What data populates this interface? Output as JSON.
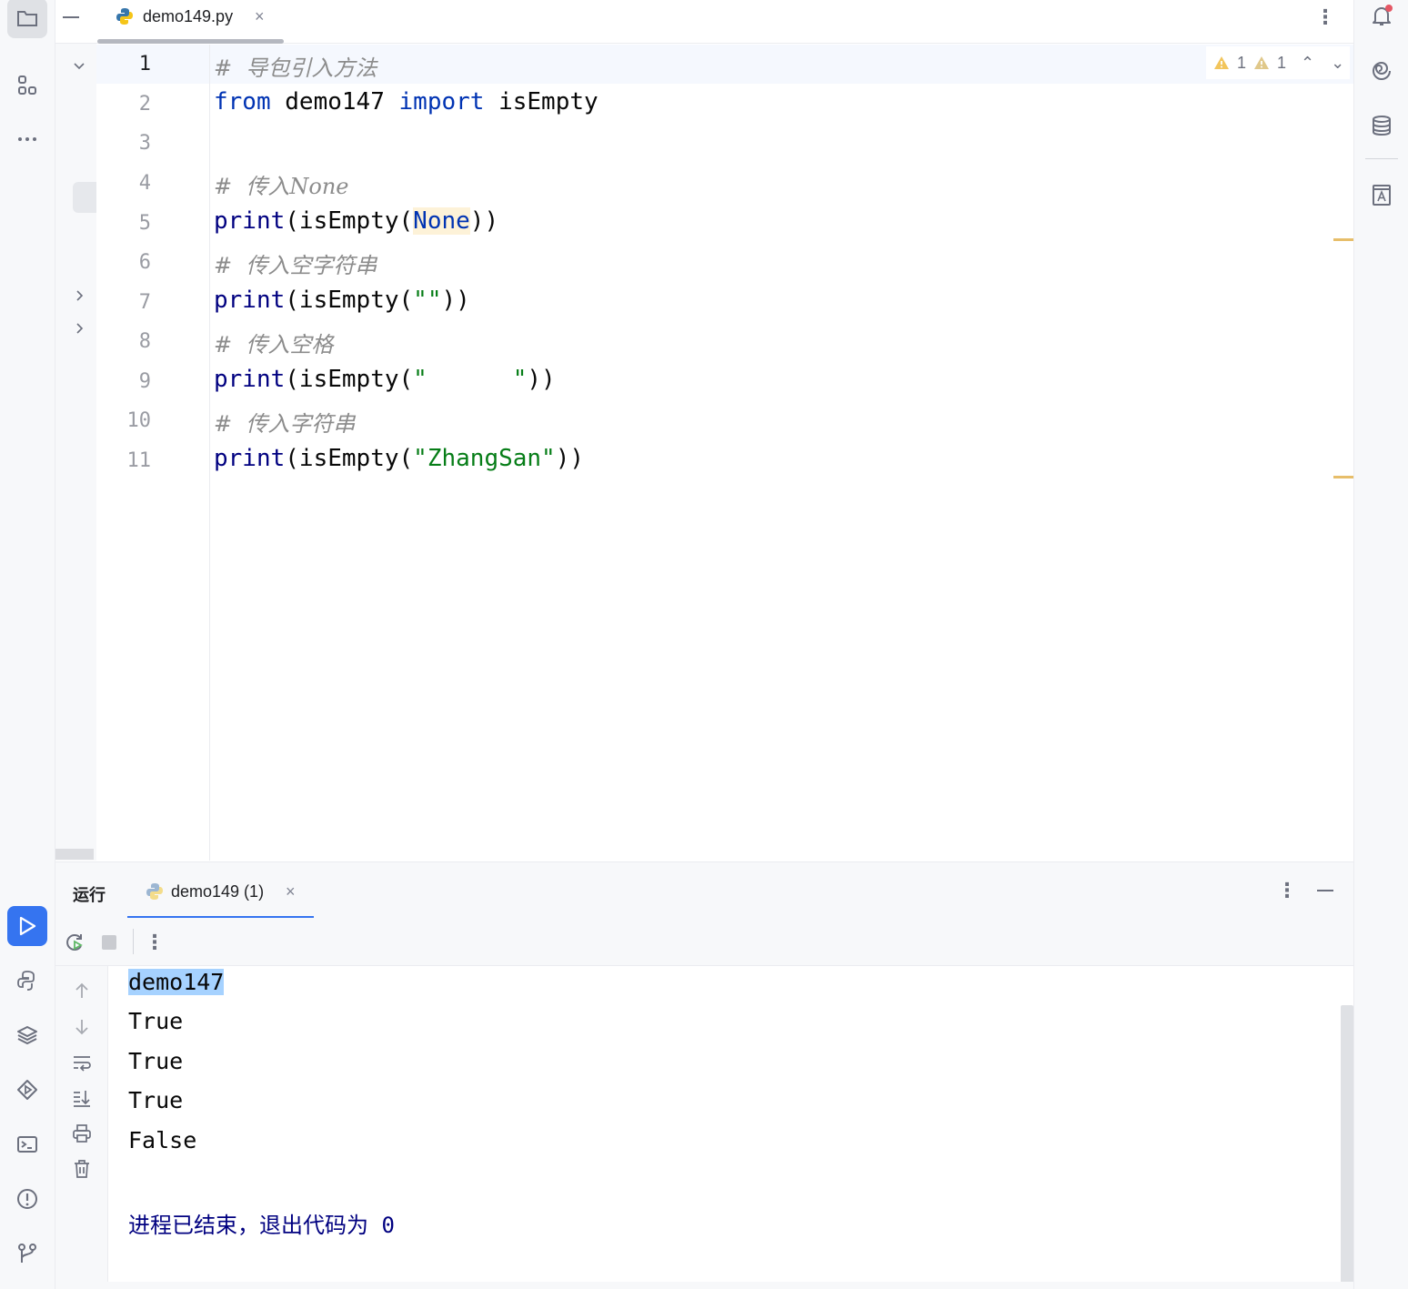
{
  "editor_tab": {
    "filename": "demo149.py",
    "close": "×"
  },
  "inspections": {
    "warnings": "1",
    "weak_warnings": "1"
  },
  "code": {
    "line_numbers": [
      "1",
      "2",
      "3",
      "4",
      "5",
      "6",
      "7",
      "8",
      "9",
      "10",
      "11"
    ],
    "l1_comment": "#  导包引入方法",
    "l2_from": "from",
    "l2_module": "demo147",
    "l2_import": "import",
    "l2_name": "isEmpty",
    "l4_comment": "#  传入None",
    "l5_print": "print",
    "l5_mid": "(isEmpty(",
    "l5_none": "None",
    "l5_end": "))",
    "l6_comment": "#  传入空字符串",
    "l7_print": "print",
    "l7_mid": "(isEmpty(",
    "l7_str": "\"\"",
    "l7_end": "))",
    "l8_comment": "#  传入空格",
    "l9_print": "print",
    "l9_mid": "(isEmpty(",
    "l9_str": "\"      \"",
    "l9_end": "))",
    "l10_comment": "#  传入字符串",
    "l11_print": "print",
    "l11_mid": "(isEmpty(",
    "l11_str": "\"ZhangSan\"",
    "l11_end": "))"
  },
  "run_panel": {
    "title": "运行",
    "tab_label": "demo149 (1)",
    "close": "×"
  },
  "console": {
    "lines": [
      "demo147",
      "True",
      "True",
      "True",
      "False"
    ],
    "exit_message": "进程已结束，退出代码为 0"
  },
  "colors": {
    "accent": "#3574f0",
    "keyword": "#0033b3",
    "string": "#067d17",
    "comment": "#8c8c8c",
    "selection": "#a6d2ff",
    "warning": "#e7be6a"
  },
  "icons": {
    "left_strip": [
      "folder-icon",
      "structure-icon",
      "more-icon",
      "run-icon",
      "python-console-icon",
      "layers-icon",
      "services-icon",
      "terminal-icon",
      "problems-icon",
      "git-icon"
    ],
    "right_strip": [
      "notifications-icon",
      "ai-assistant-icon",
      "database-icon",
      "translate-icon"
    ]
  }
}
